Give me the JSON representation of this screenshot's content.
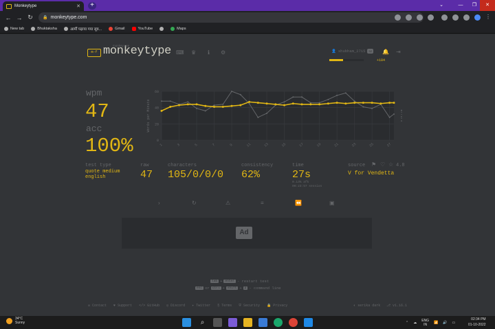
{
  "browser": {
    "tab_title": "Monkeytype",
    "tab_close": "✕",
    "new_tab": "+",
    "window_controls": {
      "down": "⌄",
      "minimize": "—",
      "restore": "❐",
      "close": "✕"
    },
    "url": "monkeytype.com",
    "bookmarks": [
      "New tab",
      "Bhuktaksha",
      "आर्मी पढ़ाया गया सूत्र...",
      "Gmail",
      "YouTube",
      "",
      "Maps"
    ]
  },
  "header": {
    "logo_box": "m-f",
    "logo_tag": "monkey see",
    "logo_name": "monkeytype",
    "username": "shubham_2715",
    "level": "52",
    "xp_fraction": 0.4,
    "xp_gain": "+184",
    "icons": [
      "keyboard-icon",
      "crown-icon",
      "info-icon",
      "gear-icon",
      "user-icon",
      "bell-icon",
      "logout-icon"
    ]
  },
  "results": {
    "wpm_label": "wpm",
    "wpm": "47",
    "acc_label": "acc",
    "acc": "100%",
    "test_type_label": "test type",
    "test_type": "quote medium",
    "language": "english",
    "raw_label": "raw",
    "raw": "47",
    "characters_label": "characters",
    "characters": "105/0/0/0",
    "consistency_label": "consistency",
    "consistency": "62%",
    "time_label": "time",
    "time": "27s",
    "time_afk": "0.13% afk",
    "time_session": "00:23:57 session",
    "source_label": "source",
    "source_rating": "4.8",
    "source": "V for Vendetta"
  },
  "actions": [
    "next-test",
    "restart",
    "report",
    "words-history",
    "replay",
    "screenshot"
  ],
  "ad_label": "Ad",
  "hints": {
    "line1": {
      "key1": "tab",
      "plus": "+",
      "key2": "enter",
      "text": "- restart test"
    },
    "line2": {
      "key1": "esc",
      "or": "or",
      "key2": "ctrl",
      "plus1": "+",
      "key3": "shift",
      "plus2": "+",
      "key4": "p",
      "text": "- command line"
    }
  },
  "footer": {
    "links": [
      "Contact",
      "Support",
      "GitHub",
      "Discord",
      "Twitter",
      "Terms",
      "Security",
      "Privacy"
    ],
    "theme": "serika dark",
    "version": "v1.16.1"
  },
  "chart_data": {
    "type": "line",
    "xlabel": "",
    "ylabel_left": "Words per Minute",
    "ylabel_right": "Errors",
    "ylim": [
      0,
      60
    ],
    "y_ticks": [
      0,
      20,
      40,
      60
    ],
    "x": [
      1,
      2,
      3,
      4,
      5,
      6,
      7,
      8,
      9,
      10,
      11,
      12,
      13,
      14,
      15,
      16,
      17,
      18,
      19,
      20,
      21,
      22,
      23,
      24,
      25,
      26,
      27,
      27.5
    ],
    "x_tick_labels": [
      "1",
      "3",
      "5",
      "7",
      "9",
      "11",
      "13",
      "15",
      "17",
      "19",
      "21",
      "23",
      "25",
      "27"
    ],
    "series": [
      {
        "name": "wpm",
        "color": "#e2b714",
        "values": [
          36,
          41,
          43,
          44,
          44,
          42,
          41,
          41,
          42,
          43,
          47,
          46,
          45,
          44,
          43,
          45,
          44,
          44,
          44,
          45,
          46,
          45,
          46,
          46,
          46,
          45,
          46,
          46
        ]
      },
      {
        "name": "raw",
        "color": "#646669",
        "values": [
          48,
          48,
          44,
          47,
          39,
          36,
          43,
          44,
          60,
          56,
          45,
          28,
          33,
          43,
          47,
          53,
          53,
          46,
          46,
          50,
          55,
          58,
          48,
          41,
          39,
          44,
          28,
          32
        ]
      }
    ]
  },
  "taskbar": {
    "temp": "34°C",
    "weather": "Sunny",
    "lang1": "ENG",
    "lang2": "IN",
    "time": "02:34 PM",
    "date": "01-10-2022"
  }
}
